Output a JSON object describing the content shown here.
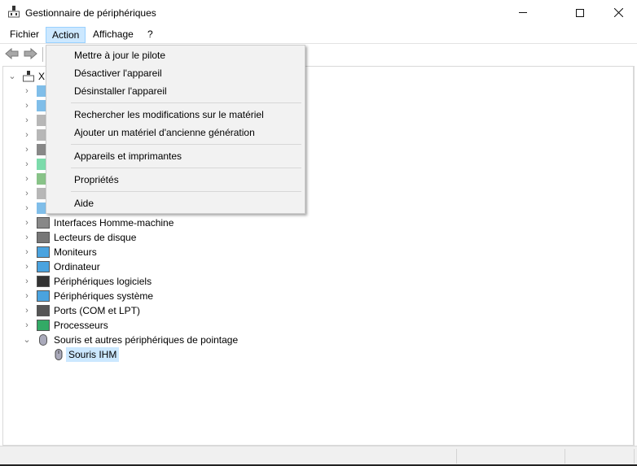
{
  "window": {
    "title": "Gestionnaire de périphériques",
    "icons": {
      "app": "device-manager-icon",
      "minimize": "minimize-icon",
      "maximize": "maximize-icon",
      "close": "close-icon"
    }
  },
  "menubar": [
    "Fichier",
    "Action",
    "Affichage",
    "?"
  ],
  "toolbar": {
    "back": "back-arrow-icon",
    "forward": "forward-arrow-icon"
  },
  "action_menu": {
    "groups": [
      [
        "Mettre à jour le pilote",
        "Désactiver l'appareil",
        "Désinstaller l'appareil"
      ],
      [
        "Rechercher les modifications sur le matériel",
        "Ajouter un matériel d'ancienne génération"
      ],
      [
        "Appareils et imprimantes"
      ],
      [
        "Propriétés"
      ],
      [
        "Aide"
      ]
    ]
  },
  "tree": {
    "root": "X",
    "visible_categories": [
      "Interfaces Homme-machine",
      "Lecteurs de disque",
      "Moniteurs",
      "Ordinateur",
      "Périphériques logiciels",
      "Périphériques système",
      "Ports (COM et LPT)",
      "Processeurs",
      "Souris et autres périphériques de pointage"
    ],
    "selected_child": "Souris IHM",
    "colors": {
      "selection": "#cce8ff",
      "menu_highlight": "#cce8ff"
    }
  }
}
